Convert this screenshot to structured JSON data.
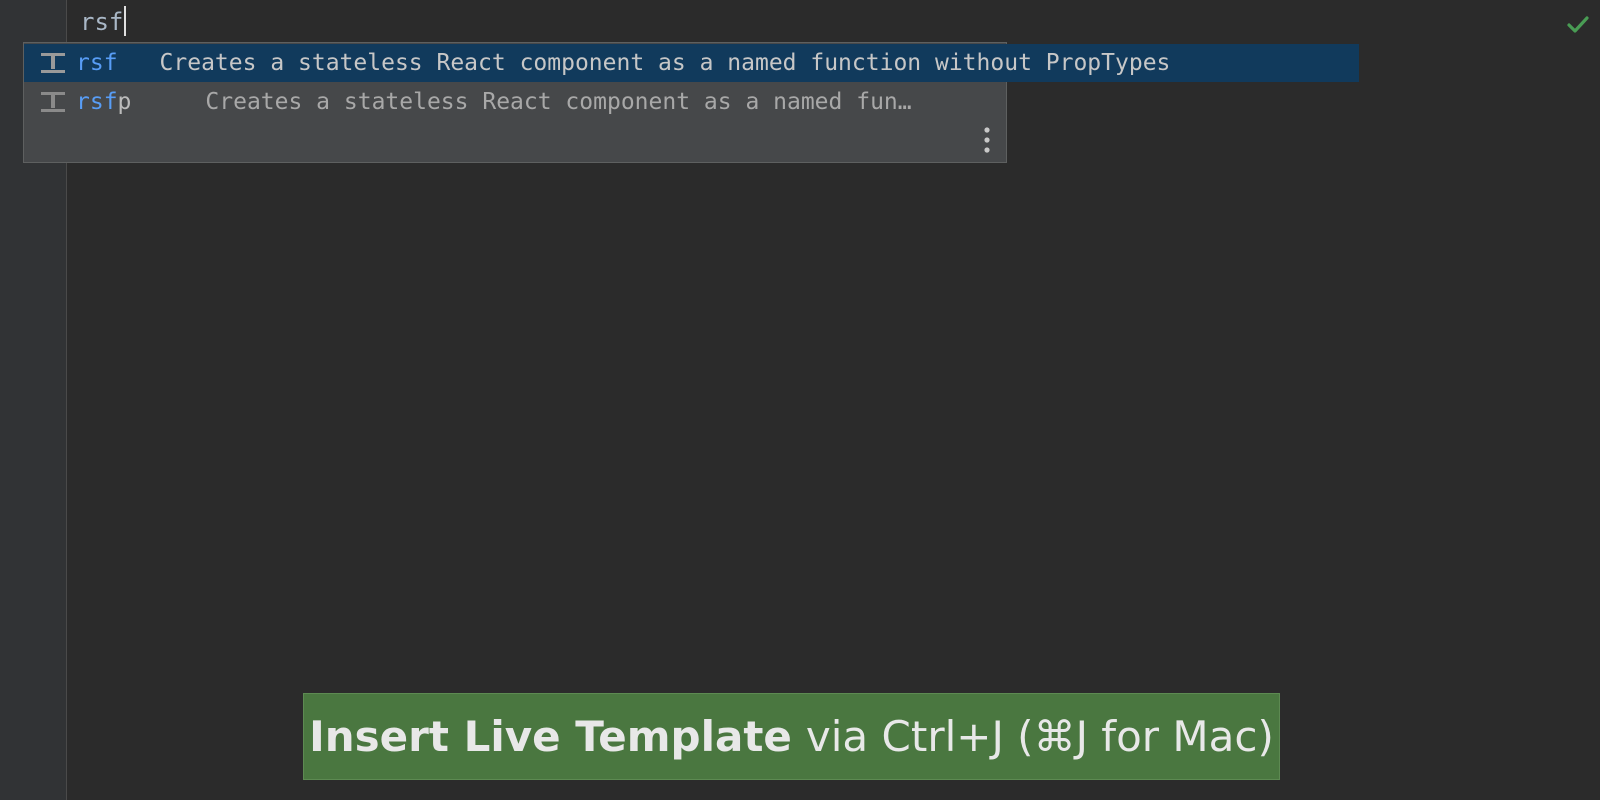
{
  "editor": {
    "typed_text": "rsf",
    "status_icon": "check-icon",
    "status_color": "#499c54"
  },
  "completion_popup": {
    "items": [
      {
        "icon": "live-template-icon",
        "abbr_match": "rsf",
        "abbr_rest": "",
        "description": "Creates a stateless React component as a named function without PropTypes",
        "selected": true
      },
      {
        "icon": "live-template-icon",
        "abbr_match": "rsf",
        "abbr_rest": "p",
        "description": "Creates a stateless React component as a named fun…",
        "selected": false
      }
    ],
    "more_icon": "more-vertical-icon",
    "selection_color": "#113a5c"
  },
  "caption": {
    "bold_text": "Insert Live Template",
    "rest_text": "via Ctrl+J (⌘J for Mac)",
    "background_color": "#4a7740"
  }
}
